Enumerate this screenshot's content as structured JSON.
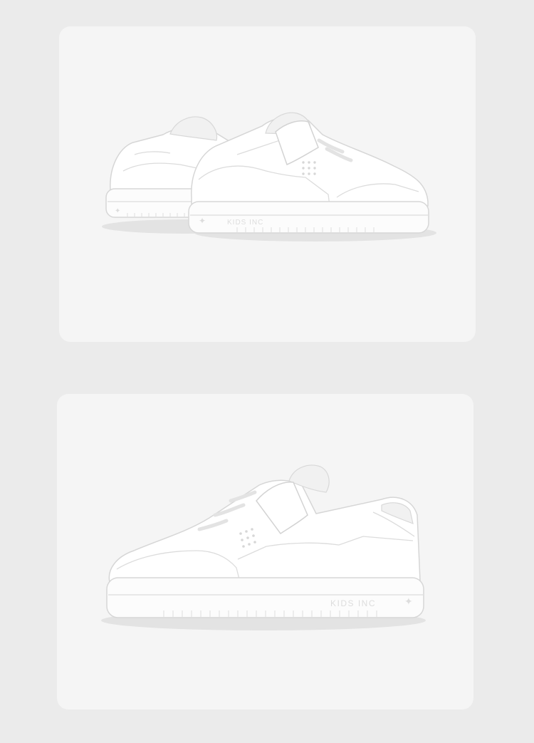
{
  "images": [
    {
      "id": "top",
      "alt": "",
      "background": "#f5f5f5",
      "shoe_color": "#ffffff",
      "sole_brand_text": "KIDS INC"
    },
    {
      "id": "bottom",
      "alt": "",
      "background": "#f5f5f5",
      "shoe_color": "#ffffff",
      "sole_brand_text": "KIDS INC"
    }
  ],
  "colors": {
    "page_background": "#ebebeb",
    "card_background": "#f5f5f5",
    "shoe_white": "#ffffff",
    "shoe_outline": "#d6d6d6"
  }
}
